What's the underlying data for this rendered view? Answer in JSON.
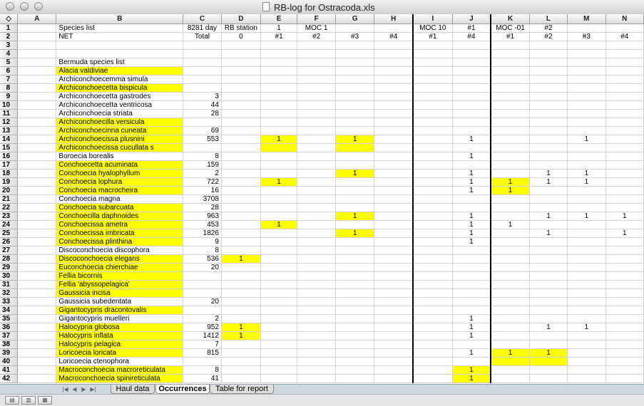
{
  "window": {
    "title": "RB-log for Ostracoda.xls"
  },
  "columns": [
    "A",
    "B",
    "C",
    "D",
    "E",
    "F",
    "G",
    "H",
    "I",
    "J",
    "K",
    "L",
    "M",
    "N"
  ],
  "header_rows": [
    {
      "num": "1",
      "cells": [
        "",
        "Species list",
        "8281 day",
        "RB station",
        "1",
        "MOC 1",
        "",
        "",
        "MOC 10",
        "#1",
        "MOC -01",
        "#2",
        "",
        ""
      ]
    },
    {
      "num": "2",
      "cells": [
        "",
        "NET",
        "Total",
        "0",
        "#1",
        "#2",
        "#3",
        "#4",
        "#1",
        "#4",
        "#1",
        "#2",
        "#3",
        "#4"
      ]
    }
  ],
  "rows": [
    {
      "num": "3",
      "species": "",
      "total": "",
      "hl": false,
      "marks": {},
      "hlcells": []
    },
    {
      "num": "4",
      "species": "",
      "total": "",
      "hl": false,
      "marks": {},
      "hlcells": []
    },
    {
      "num": "5",
      "species": "Bermuda species list",
      "total": "",
      "hl": false,
      "marks": {},
      "hlcells": []
    },
    {
      "num": "6",
      "species": "Alacia valdiviae",
      "total": "",
      "hl": true,
      "marks": {},
      "hlcells": []
    },
    {
      "num": "7",
      "species": "Archiconchoecemma simula",
      "total": "",
      "hl": false,
      "marks": {},
      "hlcells": []
    },
    {
      "num": "8",
      "species": "Archiconchoecetta bispicula",
      "total": "",
      "hl": true,
      "marks": {},
      "hlcells": []
    },
    {
      "num": "9",
      "species": "Archiconchoecetta gastrodes",
      "total": "3",
      "hl": false,
      "marks": {},
      "hlcells": []
    },
    {
      "num": "10",
      "species": "Archiconchoecetta ventricosa",
      "total": "44",
      "hl": false,
      "marks": {},
      "hlcells": []
    },
    {
      "num": "11",
      "species": "Archiconchoecia striata",
      "total": "28",
      "hl": false,
      "marks": {},
      "hlcells": []
    },
    {
      "num": "12",
      "species": "Archiconchoecilla versicula",
      "total": "",
      "hl": true,
      "marks": {},
      "hlcells": []
    },
    {
      "num": "13",
      "species": "Archiconchoecinna cuneata",
      "total": "69",
      "hl": true,
      "marks": {},
      "hlcells": []
    },
    {
      "num": "14",
      "species": "Archiconchoecissa plusnini",
      "total": "553",
      "hl": true,
      "marks": {
        "E": "1",
        "G": "1",
        "J": "1",
        "M": "1"
      },
      "hlcells": [
        "E",
        "G"
      ]
    },
    {
      "num": "15",
      "species": "Archiconchoecissa cucullata s",
      "total": "",
      "hl": true,
      "marks": {},
      "hlcells": [
        "E",
        "G"
      ]
    },
    {
      "num": "16",
      "species": "Boroecia borealis",
      "total": "8",
      "hl": false,
      "marks": {
        "J": "1"
      },
      "hlcells": []
    },
    {
      "num": "17",
      "species": "Conchoecetta acuminata",
      "total": "159",
      "hl": true,
      "marks": {},
      "hlcells": []
    },
    {
      "num": "18",
      "species": "Conchoecia hyalophyllum",
      "total": "2",
      "hl": true,
      "marks": {
        "G": "1",
        "J": "1",
        "L": "1",
        "M": "1"
      },
      "hlcells": [
        "G"
      ]
    },
    {
      "num": "19",
      "species": "Conchoecia lophura",
      "total": "722",
      "hl": true,
      "marks": {
        "E": "1",
        "J": "1",
        "K": "1",
        "L": "1",
        "M": "1"
      },
      "hlcells": [
        "E",
        "K"
      ]
    },
    {
      "num": "20",
      "species": "Conchoecia macrocheira",
      "total": "16",
      "hl": true,
      "marks": {
        "J": "1",
        "K": "1"
      },
      "hlcells": [
        "K"
      ]
    },
    {
      "num": "21",
      "species": "Conchoecia magna",
      "total": "3708",
      "hl": false,
      "marks": {},
      "hlcells": []
    },
    {
      "num": "22",
      "species": "Conchoecia subarcuata",
      "total": "28",
      "hl": true,
      "marks": {},
      "hlcells": []
    },
    {
      "num": "23",
      "species": "Conchoecilla daphnoides",
      "total": "963",
      "hl": true,
      "marks": {
        "G": "1",
        "J": "1",
        "L": "1",
        "M": "1",
        "N": "1"
      },
      "hlcells": [
        "G"
      ]
    },
    {
      "num": "24",
      "species": "Conchoecissa ametra",
      "total": "453",
      "hl": true,
      "marks": {
        "E": "1",
        "J": "1",
        "K": "1"
      },
      "hlcells": [
        "E"
      ]
    },
    {
      "num": "25",
      "species": "Conchoecissa imbricata",
      "total": "1826",
      "hl": true,
      "marks": {
        "G": "1",
        "J": "1",
        "L": "1",
        "N": "1"
      },
      "hlcells": [
        "G"
      ]
    },
    {
      "num": "26",
      "species": "Conchoecissa plinthina",
      "total": "9",
      "hl": true,
      "marks": {
        "J": "1"
      },
      "hlcells": []
    },
    {
      "num": "27",
      "species": "Discoconchoecia discophora",
      "total": "8",
      "hl": false,
      "marks": {},
      "hlcells": []
    },
    {
      "num": "28",
      "species": "Discoconchoecia elegans",
      "total": "536",
      "hl": true,
      "marks": {
        "D": "1"
      },
      "hlcells": [
        "D"
      ]
    },
    {
      "num": "29",
      "species": "Euconchoecia chierchiae",
      "total": "20",
      "hl": true,
      "marks": {},
      "hlcells": []
    },
    {
      "num": "30",
      "species": "Fellia bicornis",
      "total": "",
      "hl": true,
      "marks": {},
      "hlcells": []
    },
    {
      "num": "31",
      "species": "Fellia 'abyssopelagica'",
      "total": "",
      "hl": true,
      "marks": {},
      "hlcells": []
    },
    {
      "num": "32",
      "species": "Gaussicia incisa",
      "total": "",
      "hl": true,
      "marks": {},
      "hlcells": []
    },
    {
      "num": "33",
      "species": "Gaussicia subedentata",
      "total": "20",
      "hl": false,
      "marks": {},
      "hlcells": []
    },
    {
      "num": "34",
      "species": "Gigantocypris dracontovalis",
      "total": "",
      "hl": true,
      "marks": {},
      "hlcells": []
    },
    {
      "num": "35",
      "species": "Gigantocypris muelleri",
      "total": "2",
      "hl": false,
      "marks": {
        "J": "1"
      },
      "hlcells": []
    },
    {
      "num": "36",
      "species": "Halocypria globosa",
      "total": "952",
      "hl": true,
      "marks": {
        "D": "1",
        "J": "1",
        "L": "1",
        "M": "1"
      },
      "hlcells": [
        "D"
      ]
    },
    {
      "num": "37",
      "species": "Halocypris inflata",
      "total": "1412",
      "hl": true,
      "marks": {
        "D": "1",
        "J": "1"
      },
      "hlcells": [
        "D"
      ]
    },
    {
      "num": "38",
      "species": "Halocypris pelagica",
      "total": "7",
      "hl": true,
      "marks": {},
      "hlcells": []
    },
    {
      "num": "39",
      "species": "Loricoecia loricata",
      "total": "815",
      "hl": true,
      "marks": {
        "J": "1",
        "K": "1",
        "L": "1"
      },
      "hlcells": [
        "K",
        "L"
      ]
    },
    {
      "num": "40",
      "species": "Loricoecia ctenophora",
      "total": "",
      "hl": false,
      "marks": {},
      "hlcells": [
        "K",
        "L"
      ]
    },
    {
      "num": "41",
      "species": "Macroconchoecia macroreticulata",
      "total": "8",
      "hl": true,
      "marks": {
        "J": "1"
      },
      "hlcells": [
        "J"
      ]
    },
    {
      "num": "42",
      "species": "Macroconchoecia spinireticulata",
      "total": "41",
      "hl": true,
      "marks": {
        "J": "1"
      },
      "hlcells": [
        "J"
      ]
    }
  ],
  "tabs": [
    {
      "label": "Haul data",
      "active": false
    },
    {
      "label": "Occurrences",
      "active": true
    },
    {
      "label": "Table for report",
      "active": false
    }
  ],
  "colors": {
    "highlight": "#ffff00"
  }
}
